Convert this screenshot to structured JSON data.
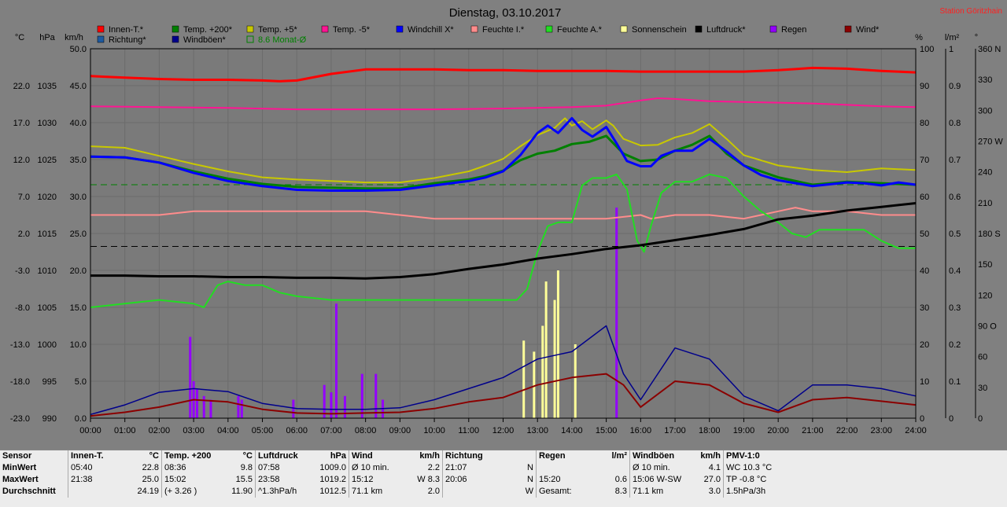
{
  "header": {
    "title": "Dienstag, 03.10.2017",
    "station": "Station Göritzhain"
  },
  "axis_units": {
    "celsius": "°C",
    "hpa": "hPa",
    "kmh": "km/h",
    "percent": "%",
    "rain": "l/m²",
    "degree": "°"
  },
  "chart_data": {
    "type": "line",
    "x_ticks": [
      "00:00",
      "01:00",
      "02:00",
      "03:00",
      "04:00",
      "05:00",
      "06:00",
      "07:00",
      "08:00",
      "09:00",
      "10:00",
      "11:00",
      "12:00",
      "13:00",
      "14:00",
      "15:00",
      "16:00",
      "17:00",
      "18:00",
      "19:00",
      "20:00",
      "21:00",
      "22:00",
      "23:00",
      "24:00"
    ],
    "y_celsius": {
      "ticks": [
        "22.0",
        "17.0",
        "12.0",
        "7.0",
        "2.0",
        "-3.0",
        "-8.0",
        "-13.0",
        "-18.0",
        "-23.0"
      ],
      "range": [
        -23,
        27
      ]
    },
    "y_hpa": {
      "ticks": [
        "1035",
        "1030",
        "1025",
        "1020",
        "1015",
        "1010",
        "1005",
        "1000",
        "995",
        "990"
      ],
      "range": [
        990,
        1040
      ]
    },
    "y_kmh": {
      "ticks": [
        "50.0",
        "45.0",
        "40.0",
        "35.0",
        "30.0",
        "25.0",
        "20.0",
        "15.0",
        "10.0",
        "5.0",
        "0.0"
      ],
      "range": [
        0,
        50
      ]
    },
    "y_percent": {
      "ticks": [
        "100",
        "90",
        "80",
        "70",
        "60",
        "50",
        "40",
        "30",
        "20",
        "10",
        "0"
      ],
      "range": [
        0,
        100
      ]
    },
    "y_rain": {
      "ticks": [
        "1",
        "0.9",
        "0.8",
        "0.7",
        "0.6",
        "0.5",
        "0.4",
        "0.3",
        "0.2",
        "0.1",
        "0"
      ],
      "range": [
        0,
        1
      ]
    },
    "y_direction": {
      "ticks": [
        "360 N",
        "330",
        "300",
        "270 W",
        "240",
        "210",
        "180 S",
        "150",
        "120",
        "90 O",
        "60",
        "30",
        "0"
      ],
      "range": [
        0,
        360
      ]
    },
    "legend": [
      {
        "label": "Innen-T.*",
        "color": "#ff0000"
      },
      {
        "label": "Temp. +200*",
        "color": "#008000"
      },
      {
        "label": "Temp. +5*",
        "color": "#c8c800"
      },
      {
        "label": "Temp. -5*",
        "color": "#ff1493"
      },
      {
        "label": "Windchill X*",
        "color": "#0000ff"
      },
      {
        "label": "Feuchte I.*",
        "color": "#ff8c8c"
      },
      {
        "label": "Feuchte A.*",
        "color": "#22dd22"
      },
      {
        "label": "Sonnenschein",
        "color": "#ffff99"
      },
      {
        "label": "Luftdruck*",
        "color": "#000000"
      },
      {
        "label": "Regen",
        "color": "#9400ff"
      },
      {
        "label": "Wind*",
        "color": "#8b0000"
      },
      {
        "label": "Richtung*",
        "color": "#1e5aa0"
      },
      {
        "label": "Windböen*",
        "color": "#00008b"
      },
      {
        "label": "8.6 Monat-Ø",
        "color": "#008000",
        "outline": true
      }
    ],
    "reference_lines": [
      {
        "axis": "celsius",
        "value": 8.6,
        "color": "#008000"
      },
      {
        "axis": "hpa",
        "value": 1013.25,
        "color": "#000000"
      }
    ],
    "series": [
      {
        "name": "Innen-T.*",
        "axis": "celsius",
        "color": "#ff0000",
        "x": [
          0,
          1,
          2,
          3,
          4,
          5,
          5.5,
          6,
          7,
          8,
          9,
          10,
          11,
          12,
          13,
          14,
          15,
          16,
          17,
          18,
          19,
          20,
          21,
          22,
          23,
          24
        ],
        "y": [
          23.3,
          23.1,
          22.9,
          22.8,
          22.8,
          22.7,
          22.6,
          22.7,
          23.6,
          24.2,
          24.2,
          24.2,
          24.1,
          24.1,
          24.0,
          24.0,
          24.0,
          23.9,
          23.9,
          23.9,
          23.9,
          24.1,
          24.4,
          24.3,
          24.0,
          23.8
        ]
      },
      {
        "name": "Temp. -5*",
        "axis": "celsius",
        "color": "#ff1493",
        "x": [
          0,
          2,
          4,
          6,
          8,
          10,
          12,
          14,
          15,
          16,
          16.5,
          17,
          18,
          19,
          20,
          21,
          22,
          23,
          24
        ],
        "y": [
          19.2,
          19.1,
          19.0,
          18.8,
          18.8,
          18.8,
          18.9,
          19.1,
          19.3,
          20.0,
          20.3,
          20.2,
          19.9,
          19.8,
          19.7,
          19.6,
          19.4,
          19.2,
          19.1
        ]
      },
      {
        "name": "Temp. +5*",
        "axis": "celsius",
        "color": "#c8c800",
        "x": [
          0,
          1,
          2,
          3,
          4,
          5,
          6,
          7,
          8,
          9,
          10,
          11,
          11.5,
          12,
          12.5,
          13,
          13.5,
          13.8,
          14,
          14.3,
          14.6,
          15,
          15.2,
          15.5,
          16,
          16.5,
          17,
          17.5,
          18,
          18.5,
          19,
          20,
          21,
          22,
          23,
          24
        ],
        "y": [
          13.8,
          13.6,
          12.5,
          11.4,
          10.4,
          9.6,
          9.3,
          9.1,
          8.9,
          8.9,
          9.5,
          10.4,
          11.2,
          12.1,
          13.8,
          15.3,
          16.3,
          17.6,
          16.6,
          17.2,
          16.1,
          17.3,
          16.6,
          14.8,
          13.9,
          14.0,
          15.0,
          15.6,
          16.8,
          14.8,
          12.6,
          11.2,
          10.6,
          10.3,
          10.8,
          10.6
        ]
      },
      {
        "name": "Temp. +200*",
        "axis": "celsius",
        "color": "#008000",
        "x": [
          0,
          1,
          2,
          3,
          4,
          5,
          6,
          7,
          8,
          9,
          10,
          11,
          11.5,
          12,
          12.5,
          13,
          13.5,
          14,
          14.5,
          15,
          15.5,
          16,
          16.5,
          17,
          17.5,
          18,
          18.5,
          19,
          20,
          21,
          22,
          23,
          24
        ],
        "y": [
          12.4,
          12.3,
          11.6,
          10.4,
          9.4,
          8.7,
          8.3,
          8.2,
          8.1,
          8.1,
          8.8,
          9.3,
          9.8,
          10.5,
          11.9,
          12.8,
          13.2,
          14.1,
          14.4,
          15.2,
          12.8,
          11.8,
          12.0,
          13.2,
          14.0,
          15.2,
          12.8,
          11.2,
          9.6,
          8.6,
          9.0,
          8.8,
          8.6
        ]
      },
      {
        "name": "Windchill X*",
        "axis": "celsius",
        "color": "#0000ff",
        "x": [
          0,
          1,
          2,
          3,
          4,
          5,
          6,
          7,
          8,
          9,
          10,
          11,
          11.5,
          12,
          12.5,
          13,
          13.3,
          13.6,
          14,
          14.3,
          14.6,
          15,
          15.3,
          15.6,
          16,
          16.3,
          16.6,
          17,
          17.5,
          18,
          18.5,
          19,
          19.5,
          20,
          21,
          22,
          22.5,
          23,
          23.5,
          24
        ],
        "y": [
          12.4,
          12.3,
          11.6,
          10.2,
          9.1,
          8.4,
          7.9,
          7.8,
          7.8,
          7.9,
          8.5,
          9.1,
          9.6,
          10.4,
          12.6,
          15.6,
          16.6,
          15.6,
          17.6,
          16.0,
          15.1,
          16.4,
          14.2,
          11.8,
          11.1,
          11.1,
          12.5,
          13.2,
          13.2,
          14.8,
          13.1,
          11.2,
          9.9,
          9.2,
          8.4,
          8.9,
          8.8,
          8.5,
          8.9,
          8.6
        ]
      },
      {
        "name": "Feuchte I.*",
        "axis": "percent",
        "color": "#ff8c8c",
        "x": [
          0,
          1,
          2,
          3,
          4,
          5,
          6,
          7,
          8,
          9,
          10,
          11,
          12,
          13,
          14,
          15,
          16,
          16.3,
          17,
          18,
          19,
          19.5,
          20,
          20.5,
          21,
          22,
          23,
          24
        ],
        "y": [
          55,
          55,
          55,
          56,
          56,
          56,
          56,
          56,
          56,
          55,
          54,
          54,
          54,
          54,
          54,
          54,
          55,
          54,
          55,
          55,
          54,
          55,
          56,
          57,
          56,
          56,
          55,
          55
        ]
      },
      {
        "name": "Feuchte A.*",
        "axis": "percent",
        "color": "#22dd22",
        "x": [
          0,
          1,
          2,
          3,
          3.3,
          3.7,
          4,
          4.5,
          5,
          5.5,
          6,
          7,
          8,
          9,
          10,
          11,
          12,
          12.4,
          12.7,
          13,
          13.3,
          13.6,
          14,
          14.3,
          14.6,
          15,
          15.3,
          15.6,
          15.9,
          16.1,
          16.3,
          16.6,
          17,
          17.5,
          18,
          18.5,
          19,
          19.5,
          20,
          20.4,
          20.8,
          21.2,
          21.6,
          22,
          22.5,
          23,
          23.5,
          24
        ],
        "y": [
          30,
          31,
          32,
          31,
          30,
          36,
          37,
          36,
          36,
          34,
          33,
          32,
          32,
          32,
          32,
          32,
          32,
          32,
          35,
          45,
          52,
          53,
          53,
          63,
          65,
          65,
          66,
          62,
          48,
          45,
          52,
          61,
          64,
          64,
          66,
          65,
          60,
          56,
          53,
          50,
          49,
          51,
          51,
          51,
          51,
          48,
          46,
          46
        ]
      },
      {
        "name": "Luftdruck*",
        "axis": "hpa",
        "color": "#000000",
        "x": [
          0,
          1,
          2,
          3,
          4,
          5,
          6,
          7,
          8,
          9,
          10,
          11,
          12,
          13,
          14,
          15,
          16,
          17,
          18,
          19,
          20,
          21,
          22,
          23,
          24
        ],
        "y": [
          1009.3,
          1009.3,
          1009.2,
          1009.2,
          1009.1,
          1009.1,
          1009.0,
          1009.0,
          1008.9,
          1009.1,
          1009.5,
          1010.2,
          1010.8,
          1011.6,
          1012.2,
          1012.9,
          1013.4,
          1014.1,
          1014.8,
          1015.6,
          1016.9,
          1017.4,
          1018.1,
          1018.6,
          1019.1
        ]
      },
      {
        "name": "Wind*",
        "axis": "kmh",
        "color": "#8b0000",
        "x": [
          0,
          1,
          2,
          3,
          4,
          5,
          6,
          7,
          8,
          9,
          10,
          11,
          12,
          13,
          14,
          15,
          15.5,
          16,
          17,
          18,
          19,
          20,
          21,
          22,
          23,
          24
        ],
        "y": [
          0.3,
          0.8,
          1.5,
          2.5,
          2.2,
          1.2,
          0.7,
          0.6,
          0.7,
          0.8,
          1.3,
          2.2,
          2.8,
          4.5,
          5.5,
          6.0,
          4.5,
          1.5,
          5.0,
          4.5,
          2.0,
          0.8,
          2.5,
          2.8,
          2.3,
          1.8
        ]
      },
      {
        "name": "Windböen*",
        "axis": "kmh",
        "color": "#00008b",
        "x": [
          0,
          1,
          2,
          3,
          4,
          5,
          6,
          7,
          8,
          9,
          10,
          11,
          12,
          13,
          14,
          15,
          15.5,
          16,
          17,
          18,
          19,
          20,
          21,
          22,
          23,
          24
        ],
        "y": [
          0.5,
          1.8,
          3.5,
          4.0,
          3.6,
          2.0,
          1.3,
          1.2,
          1.2,
          1.4,
          2.5,
          4.0,
          5.5,
          8.0,
          9.0,
          12.5,
          6.0,
          2.5,
          9.5,
          8.0,
          3.0,
          1.0,
          4.5,
          4.5,
          4.0,
          3.0
        ]
      }
    ],
    "rain_bars": {
      "axis": "rain",
      "color": "#9400ff",
      "x": [
        2.9,
        3.0,
        3.1,
        3.3,
        3.5,
        4.3,
        4.4,
        5.9,
        6.8,
        7.0,
        7.15,
        7.4,
        7.9,
        8.3,
        8.5,
        15.3
      ],
      "y": [
        0.22,
        0.1,
        0.08,
        0.06,
        0.05,
        0.06,
        0.05,
        0.05,
        0.09,
        0.07,
        0.31,
        0.06,
        0.12,
        0.12,
        0.05,
        0.57
      ]
    },
    "sunshine_bars": {
      "axis": "percent",
      "color": "#ffff99",
      "x": [
        12.6,
        12.9,
        13.15,
        13.25,
        13.5,
        13.6,
        14.1
      ],
      "y": [
        21,
        18,
        25,
        37,
        32,
        40,
        20
      ]
    }
  },
  "stats": {
    "rows": [
      "MinWert",
      "MaxWert",
      "Durchschnitt"
    ],
    "sensor_label": "Sensor",
    "cols": [
      {
        "name": "Innen-T.",
        "unit": "°C",
        "cells": [
          [
            "05:40",
            "22.8"
          ],
          [
            "21:38",
            "25.0"
          ],
          [
            "",
            "24.19"
          ]
        ]
      },
      {
        "name": "Temp. +200",
        "unit": "°C",
        "cells": [
          [
            "08:36",
            "9.8"
          ],
          [
            "15:02",
            "15.5"
          ],
          [
            "(+ 3.26 )",
            "11.90"
          ]
        ]
      },
      {
        "name": "Luftdruck",
        "unit": "hPa",
        "cells": [
          [
            "07:58",
            "1009.0"
          ],
          [
            "23:58",
            "1019.2"
          ],
          [
            "^1.3hPa/h",
            "1012.5"
          ]
        ]
      },
      {
        "name": "Wind",
        "unit": "km/h",
        "cells": [
          [
            "Ø 10 min.",
            "2.2"
          ],
          [
            "15:12",
            "W 8.3"
          ],
          [
            "71.1 km",
            "2.0"
          ]
        ]
      },
      {
        "name": "Richtung",
        "unit": "",
        "cells": [
          [
            "21:07",
            "N"
          ],
          [
            "20:06",
            "N"
          ],
          [
            "",
            "W"
          ]
        ]
      },
      {
        "name": "Regen",
        "unit": "l/m²",
        "cells": [
          [
            "",
            ""
          ],
          [
            "15:20",
            "0.6"
          ],
          [
            "Gesamt:",
            "8.3"
          ]
        ]
      },
      {
        "name": "Windböen",
        "unit": "km/h",
        "cells": [
          [
            "Ø 10 min.",
            "4.1"
          ],
          [
            "15:06  W-SW",
            "27.0"
          ],
          [
            "71.1 km",
            "3.0"
          ]
        ]
      },
      {
        "name": "PMV-1:0",
        "unit": "",
        "cells": [
          [
            "WC 10.3 °C",
            ""
          ],
          [
            "TP -0.8 °C",
            ""
          ],
          [
            "1.5hPa/3h",
            ""
          ]
        ]
      }
    ]
  }
}
